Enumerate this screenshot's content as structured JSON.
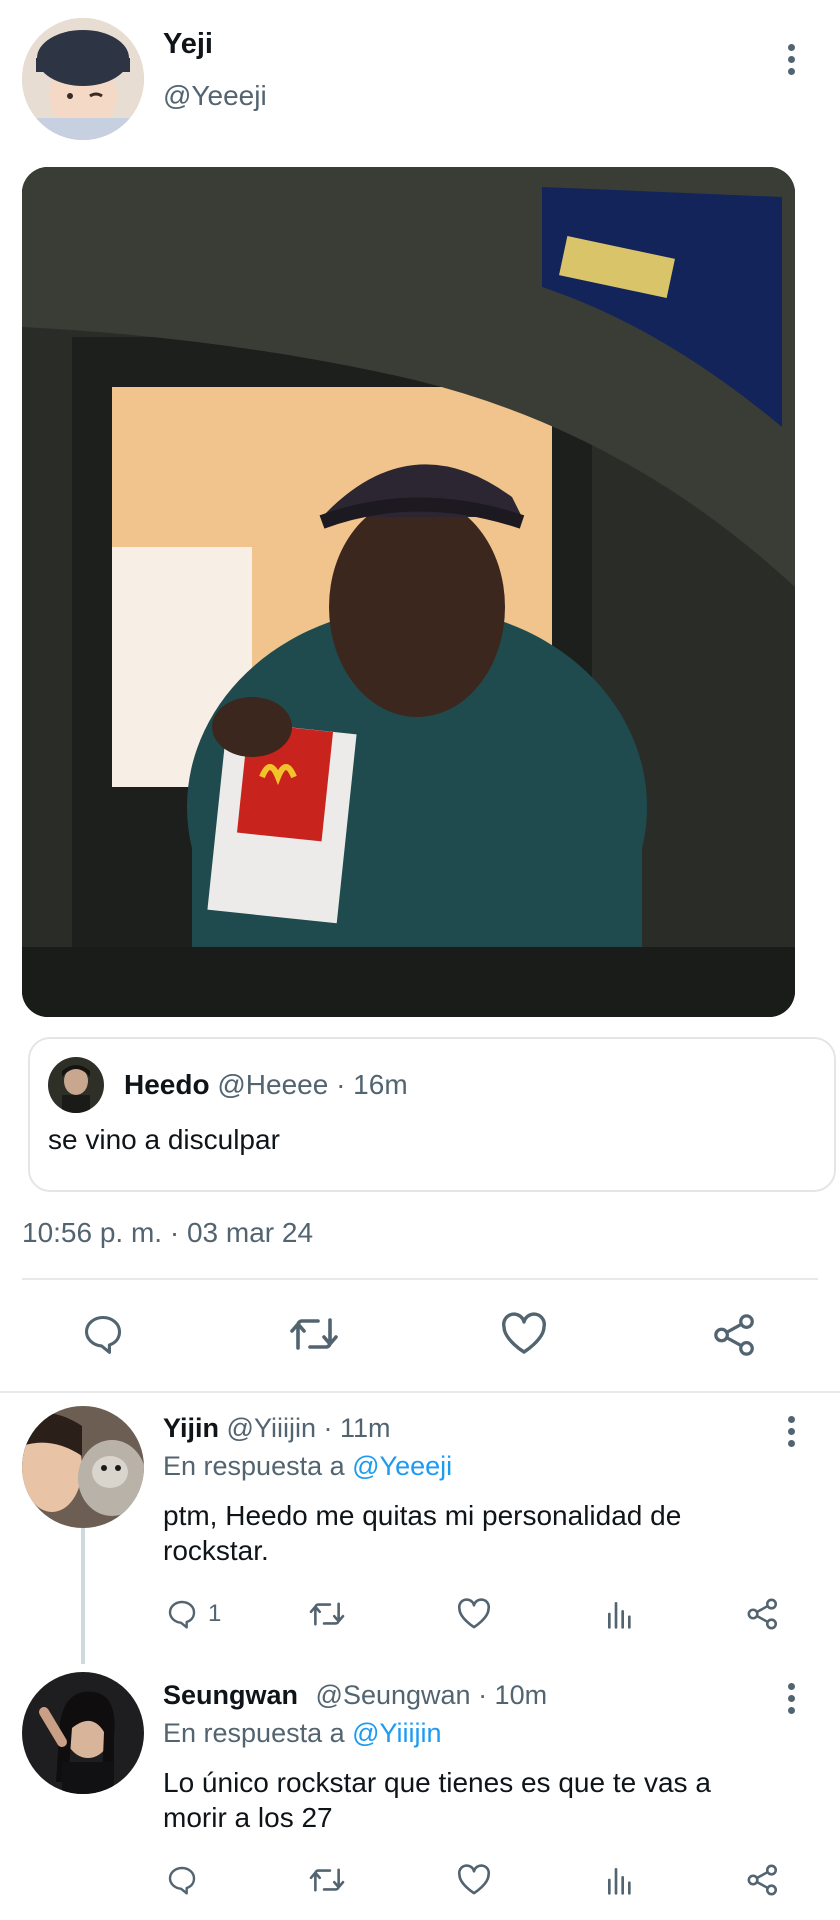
{
  "main_tweet": {
    "author_name": "Yeji",
    "author_handle": "@Yeeeji",
    "quoted": {
      "author_name": "Heedo",
      "author_handle": "@Heeee",
      "age": "· 16m",
      "text": "se vino a disculpar"
    },
    "timestamp": "10:56 p. m. · 03 mar 24"
  },
  "replies": [
    {
      "author_name": "Yijin",
      "author_handle": "@Yiiijin",
      "age": "· 11m",
      "reply_prefix": "En respuesta a",
      "reply_to": "@Yeeeji",
      "text_line1": "ptm, Heedo me quitas mi personalidad de",
      "text_line2": "rockstar.",
      "reply_count": "1"
    },
    {
      "author_name": "Seungwan",
      "author_handle": "@Seungwan",
      "age": "· 10m",
      "reply_prefix": "En respuesta a",
      "reply_to": "@Yiiijin",
      "text_line1": "Lo único rockstar que tienes es que te vas a",
      "text_line2": "morir a los 27"
    }
  ],
  "colors": {
    "text": "#0f1419",
    "secondary": "#536471",
    "link": "#1d9bf0",
    "divider": "#e7e9ea"
  }
}
